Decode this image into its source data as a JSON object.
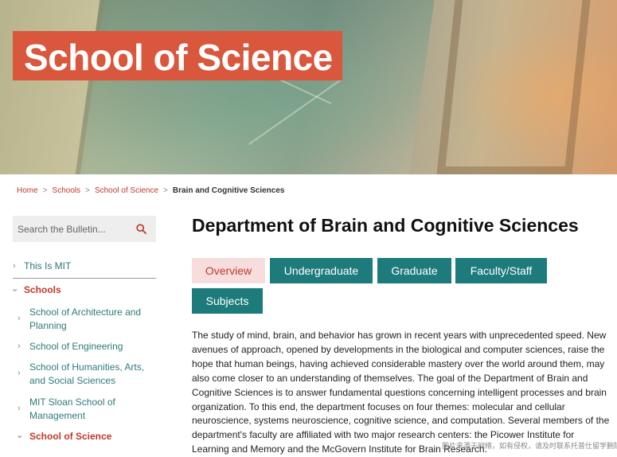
{
  "hero": {
    "title": "School of Science"
  },
  "breadcrumb": {
    "items": [
      "Home",
      "Schools",
      "School of Science"
    ],
    "current": "Brain and Cognitive Sciences"
  },
  "search": {
    "placeholder": "Search the Bulletin..."
  },
  "sidebar": {
    "items": [
      {
        "label": "This Is MIT"
      },
      {
        "label": "Schools"
      },
      {
        "label": "School of Architecture and Planning"
      },
      {
        "label": "School of Engineering"
      },
      {
        "label": "School of Humanities, Arts, and Social Sciences"
      },
      {
        "label": "MIT Sloan School of Management"
      },
      {
        "label": "School of Science"
      }
    ]
  },
  "main": {
    "title": "Department of Brain and Cognitive Sciences",
    "tabs": [
      {
        "label": "Overview"
      },
      {
        "label": "Undergraduate"
      },
      {
        "label": "Graduate"
      },
      {
        "label": "Faculty/Staff"
      },
      {
        "label": "Subjects"
      }
    ],
    "body": "The study of mind, brain, and behavior has grown in recent years with unprecedented speed. New avenues of approach, opened by developments in the biological and computer sciences, raise the hope that human beings, having achieved considerable mastery over the world around them, may also come closer to an understanding of themselves. The goal of the Department of Brain and Cognitive Sciences is to answer fundamental questions concerning intelligent processes and brain organization. To this end, the department focuses on four themes: molecular and cellular neuroscience, systems neuroscience, cognitive science, and computation. Several members of the department's faculty are affiliated with two major research centers: the Picower Institute for Learning and Memory and the McGovern Institute for Brain Research."
  },
  "watermark": "图片来源于网络，如有侵权，请及时联系托普仕留学删除",
  "colors": {
    "brand_red": "#d9573c",
    "tab_teal": "#1e7b7c",
    "tab_active_bg": "#f7dddd",
    "link_red": "#c0392b",
    "sidebar_teal": "#2e7a7a"
  }
}
